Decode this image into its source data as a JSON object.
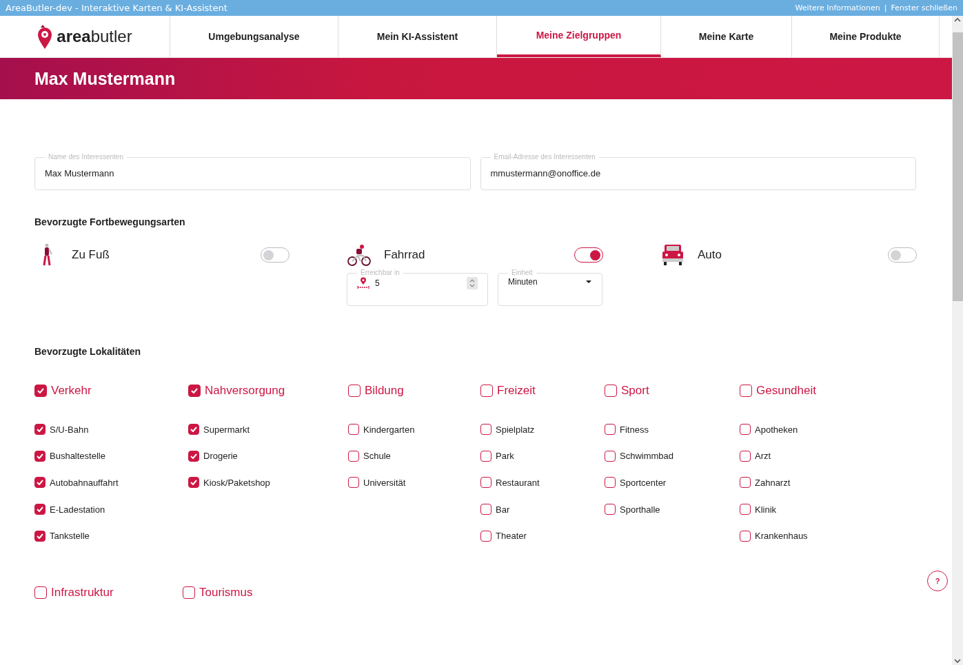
{
  "window": {
    "title": "AreaButler-dev - Interaktive Karten & KI-Assistent",
    "links": [
      "Weitere Informationen",
      "Fenster schließen"
    ],
    "link_separator": "|"
  },
  "logo": {
    "text_bold": "area",
    "text_light": "butler"
  },
  "tabs": [
    {
      "label": "Umgebungsanalyse",
      "selected": false
    },
    {
      "label": "Mein KI-Assistent",
      "selected": false
    },
    {
      "label": "Meine Zielgruppen",
      "selected": true
    },
    {
      "label": "Meine Karte",
      "selected": false
    },
    {
      "label": "Meine Produkte",
      "selected": false
    }
  ],
  "banner": {
    "title": "Max Mustermann"
  },
  "fields": [
    {
      "label": "Name des Interessenten",
      "value": "Max Mustermann"
    },
    {
      "label": "Email-Adresse des Interessenten",
      "value": "mmustermann@onoffice.de"
    }
  ],
  "transport": {
    "heading": "Bevorzugte Fortbewegungsarten",
    "modes": [
      {
        "kind": "walk",
        "label": "Zu Fuß",
        "on": false
      },
      {
        "kind": "bike",
        "label": "Fahrrad",
        "on": true,
        "reachable": {
          "label": "Erreichbar in",
          "value": "5"
        },
        "unit": {
          "label": "Einheit",
          "value": "Minuten"
        }
      },
      {
        "kind": "car",
        "label": "Auto",
        "on": false
      }
    ]
  },
  "localities": {
    "heading": "Bevorzugte Lokalitäten",
    "groups": [
      {
        "label": "Verkehr",
        "checked": true,
        "items": [
          {
            "label": "S/U-Bahn",
            "checked": true
          },
          {
            "label": "Bushaltestelle",
            "checked": true
          },
          {
            "label": "Autobahnauffahrt",
            "checked": true
          },
          {
            "label": "E-Ladestation",
            "checked": true
          },
          {
            "label": "Tankstelle",
            "checked": true
          }
        ]
      },
      {
        "label": "Nahversorgung",
        "checked": true,
        "items": [
          {
            "label": "Supermarkt",
            "checked": true
          },
          {
            "label": "Drogerie",
            "checked": true
          },
          {
            "label": "Kiosk/Paketshop",
            "checked": true
          }
        ]
      },
      {
        "label": "Bildung",
        "checked": false,
        "items": [
          {
            "label": "Kindergarten",
            "checked": false
          },
          {
            "label": "Schule",
            "checked": false
          },
          {
            "label": "Universität",
            "checked": false
          }
        ]
      },
      {
        "label": "Freizeit",
        "checked": false,
        "items": [
          {
            "label": "Spielplatz",
            "checked": false
          },
          {
            "label": "Park",
            "checked": false
          },
          {
            "label": "Restaurant",
            "checked": false
          },
          {
            "label": "Bar",
            "checked": false
          },
          {
            "label": "Theater",
            "checked": false
          }
        ]
      },
      {
        "label": "Sport",
        "checked": false,
        "items": [
          {
            "label": "Fitness",
            "checked": false
          },
          {
            "label": "Schwimmbad",
            "checked": false
          },
          {
            "label": "Sportcenter",
            "checked": false
          },
          {
            "label": "Sporthalle",
            "checked": false
          }
        ]
      },
      {
        "label": "Gesundheit",
        "checked": false,
        "items": [
          {
            "label": "Apotheken",
            "checked": false
          },
          {
            "label": "Arzt",
            "checked": false
          },
          {
            "label": "Zahnarzt",
            "checked": false
          },
          {
            "label": "Klinik",
            "checked": false
          },
          {
            "label": "Krankenhaus",
            "checked": false
          }
        ]
      }
    ],
    "more_groups": [
      {
        "label": "Infrastruktur",
        "checked": false
      },
      {
        "label": "Tourismus",
        "checked": false
      }
    ]
  },
  "help_button": {
    "label": "?"
  }
}
